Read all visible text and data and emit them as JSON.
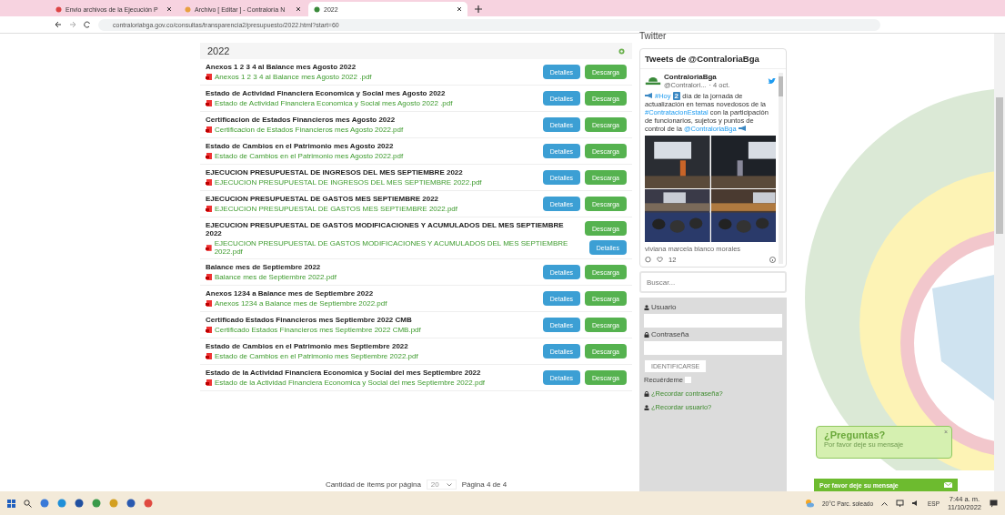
{
  "browser": {
    "tabs": [
      {
        "title": "Envio archivos de la Ejecución P",
        "selected": false
      },
      {
        "title": "Archivo [ Editar ] - Contraloría N",
        "selected": false
      },
      {
        "title": "2022",
        "selected": true
      }
    ],
    "address": "contraloriabga.gov.co/consultas/transparencia2/presupuesto/2022.html?start=60"
  },
  "list": {
    "title": "2022",
    "items": [
      {
        "kind": "inline",
        "title": "Anexos 1 2 3 4 al Balance mes Agosto 2022",
        "file": "Anexos 1 2 3 4 al Balance mes Agosto 2022 .pdf",
        "details": "Detalles",
        "download": "Descarga"
      },
      {
        "kind": "inline",
        "title": "Estado de Actividad Financiera Economica y Social mes Agosto 2022",
        "file": "Estado de Actividad Financiera Economica y Social mes Agosto 2022 .pdf",
        "details": "Detalles",
        "download": "Descarga"
      },
      {
        "kind": "inline",
        "title": "Certificacion de Estados Financieros mes Agosto 2022",
        "file": "Certificacion de Estados Financieros mes Agosto 2022.pdf",
        "details": "Detalles",
        "download": "Descarga"
      },
      {
        "kind": "inline",
        "title": "Estado de Cambios en el Patrimonio mes Agosto 2022",
        "file": "Estado de Cambios en el Patrimonio mes Agosto 2022.pdf",
        "details": "Detalles",
        "download": "Descarga"
      },
      {
        "kind": "inline",
        "title": "EJECUCION PRESUPUESTAL DE INGRESOS DEL MES SEPTIEMBRE 2022",
        "file": "EJECUCION PRESUPUESTAL DE INGRESOS DEL MES SEPTIEMBRE 2022.pdf",
        "details": "Detalles",
        "download": "Descarga"
      },
      {
        "kind": "inline",
        "title": "EJECUCION PRESUPUESTAL DE GASTOS MES SEPTIEMBRE 2022",
        "file": "EJECUCION PRESUPUESTAL DE GASTOS MES SEPTIEMBRE 2022.pdf",
        "details": "Detalles",
        "download": "Descarga"
      },
      {
        "kind": "stacked",
        "title": "EJECUCION PRESUPUESTAL DE GASTOS MODIFICACIONES Y ACUMULADOS DEL MES SEPTIEMBRE 2022",
        "file": "EJECUCION PRESUPUESTAL DE GASTOS MODIFICACIONES Y ACUMULADOS DEL MES SEPTIEMBRE 2022.pdf",
        "details": "Detalles",
        "download": "Descarga"
      },
      {
        "kind": "inline",
        "title": "Balance mes de Septiembre 2022",
        "file": "Balance mes de Septiembre 2022.pdf",
        "details": "Detalles",
        "download": "Descarga"
      },
      {
        "kind": "inline",
        "title": "Anexos 1234 a Balance mes de Septiembre 2022",
        "file": "Anexos 1234 a Balance mes de Septiembre 2022.pdf",
        "details": "Detalles",
        "download": "Descarga"
      },
      {
        "kind": "inline",
        "title": "Certificado Estados Financieros mes Septiembre 2022 CMB",
        "file": "Certificado Estados Financieros mes Septiembre 2022 CMB.pdf",
        "details": "Detalles",
        "download": "Descarga"
      },
      {
        "kind": "inline",
        "title": "Estado de Cambios en el Patrimonio mes Septiembre 2022",
        "file": "Estado de Cambios en el Patrimonio mes Septiembre 2022.pdf",
        "details": "Detalles",
        "download": "Descarga"
      },
      {
        "kind": "inline",
        "title": "Estado de la Actividad Financiera Economica y Social del mes Septiembre 2022",
        "file": "Estado de la Actividad Financiera Economica y Social del mes Septiembre 2022.pdf",
        "details": "Detalles",
        "download": "Descarga"
      }
    ],
    "pagination": {
      "label": "Cantidad de ítems por página",
      "per_page": "20",
      "page": "Página 4 de 4"
    }
  },
  "twitter": {
    "heading": "Twitter",
    "title": "Tweets de @ContraloriaBga",
    "name": "ContraloriaBga",
    "handle": "@Contralori...",
    "date": "· 4 oct.",
    "tweet": [
      {
        "kind": "emoji"
      },
      {
        "kind": "link",
        "text": "#Hoy"
      },
      {
        "kind": "keycap",
        "text": "2"
      },
      {
        "kind": "text",
        "text": "día de la jornada de actualización en temas novedosos de la"
      },
      {
        "kind": "link",
        "text": "#ContratacionEstatal"
      },
      {
        "kind": "text",
        "text": "con la participación de funcionarios, sujetos y puntos de control de la"
      },
      {
        "kind": "link",
        "text": "@ContraloriaBga"
      },
      {
        "kind": "emoji"
      }
    ],
    "caption": "viviana marcela blanco morales",
    "likes": "12"
  },
  "search": {
    "placeholder": "Buscar..."
  },
  "login": {
    "user_label": "Usuario",
    "password_label": "Contraseña",
    "submit": "IDENTIFICARSE",
    "remember": "Recuérdeme",
    "remember_checked": false,
    "forgot_password": "¿Recordar contraseña?",
    "forgot_user": "¿Recordar usuario?"
  },
  "chat": {
    "title": "¿Preguntas?",
    "subtitle": "Por favor deje su mensaje",
    "close": "×",
    "bar": "Por favor deje su mensaje"
  },
  "taskbar": {
    "weather": "20°C Parc. soleado",
    "language": "ESP",
    "time": "7:44 a. m.",
    "date": "11/10/2022"
  }
}
